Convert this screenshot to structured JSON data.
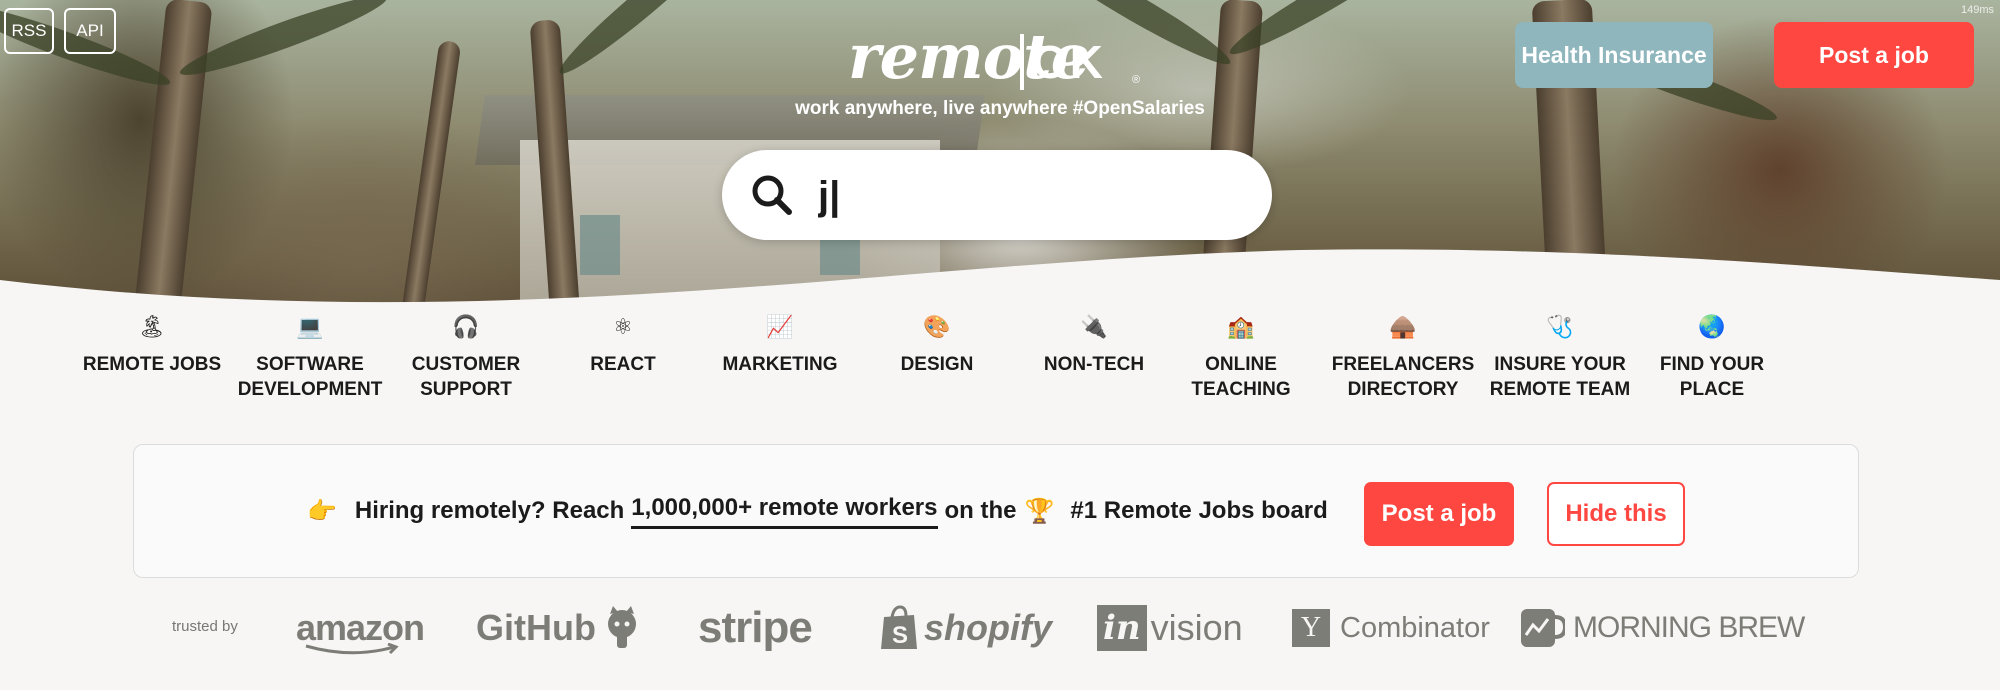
{
  "header": {
    "rss_label": "RSS",
    "api_label": "API",
    "logo_word": "remote",
    "logo_ok": "OK",
    "logo_reg": "®",
    "tagline": "work anywhere, live anywhere #OpenSalaries",
    "timing": "149ms",
    "health_insurance_label": "Health Insurance",
    "post_job_label": "Post a job",
    "colors": {
      "health_insurance": "#8fb6bd",
      "post_job": "#ff4742"
    }
  },
  "search": {
    "value": "j|",
    "icon": "search-icon"
  },
  "categories": [
    {
      "icon": "🏝",
      "label": "REMOTE JOBS"
    },
    {
      "icon": "💻",
      "label": "SOFTWARE DEVELOPMENT"
    },
    {
      "icon": "🎧",
      "label": "CUSTOMER SUPPORT"
    },
    {
      "icon": "⚛",
      "label": "REACT"
    },
    {
      "icon": "📈",
      "label": "MARKETING"
    },
    {
      "icon": "🎨",
      "label": "DESIGN"
    },
    {
      "icon": "🔌",
      "label": "NON-TECH"
    },
    {
      "icon": "🏫",
      "label": "ONLINE TEACHING"
    },
    {
      "icon": "🛖",
      "label": "FREELANCERS DIRECTORY"
    },
    {
      "icon": "🩺",
      "label": "INSURE YOUR REMOTE TEAM"
    },
    {
      "icon": "🌏",
      "label": "FIND YOUR PLACE"
    }
  ],
  "banner": {
    "pointer_icon": "👉",
    "text_before": "Hiring remotely? Reach",
    "link_text": "1,000,000+ remote workers",
    "text_mid": "on the",
    "trophy_icon": "🏆",
    "text_after": "#1 Remote Jobs board",
    "post_job_label": "Post a job",
    "hide_label": "Hide this"
  },
  "trusted": {
    "label": "trusted by",
    "brands": [
      "amazon",
      "GitHub",
      "stripe",
      "shopify",
      "invision",
      "Combinator",
      "MORNING BREW"
    ],
    "yc_letter": "Y",
    "invision_in": "in",
    "invision_rest": "vision"
  }
}
